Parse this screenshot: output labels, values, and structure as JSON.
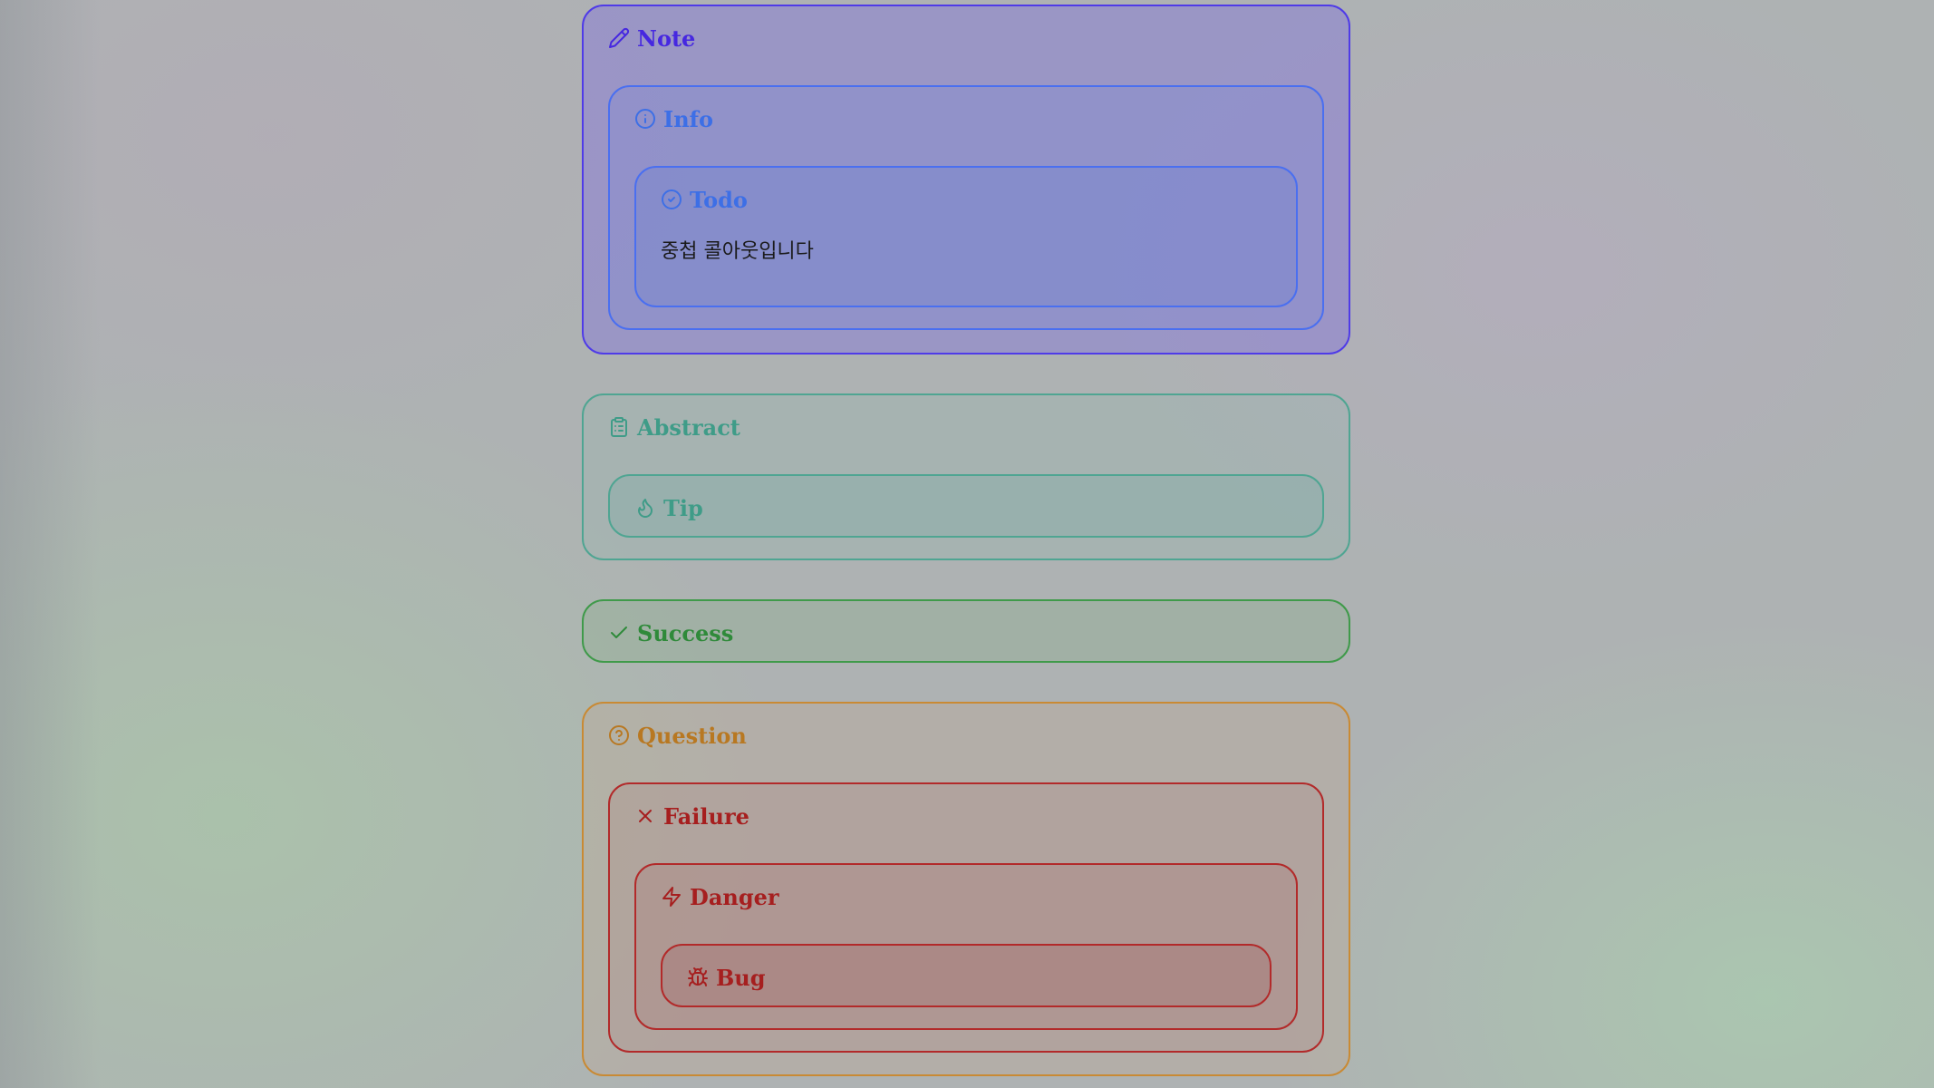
{
  "callouts": {
    "note": {
      "title": "Note",
      "icon": "pencil-icon"
    },
    "info": {
      "title": "Info",
      "icon": "info-icon"
    },
    "todo": {
      "title": "Todo",
      "icon": "check-circle-icon",
      "content": "중첩 콜아웃입니다"
    },
    "abstract": {
      "title": "Abstract",
      "icon": "clipboard-icon"
    },
    "tip": {
      "title": "Tip",
      "icon": "flame-icon"
    },
    "success": {
      "title": "Success",
      "icon": "check-icon"
    },
    "question": {
      "title": "Question",
      "icon": "help-circle-icon"
    },
    "failure": {
      "title": "Failure",
      "icon": "x-icon"
    },
    "danger": {
      "title": "Danger",
      "icon": "zap-icon"
    },
    "bug": {
      "title": "Bug",
      "icon": "bug-icon"
    }
  },
  "colors": {
    "note": "#4628e0",
    "info": "#3d6fe6",
    "abstract": "#3f9c88",
    "success": "#2f8a3a",
    "question": "#b87822",
    "failure": "#a61f1f"
  }
}
